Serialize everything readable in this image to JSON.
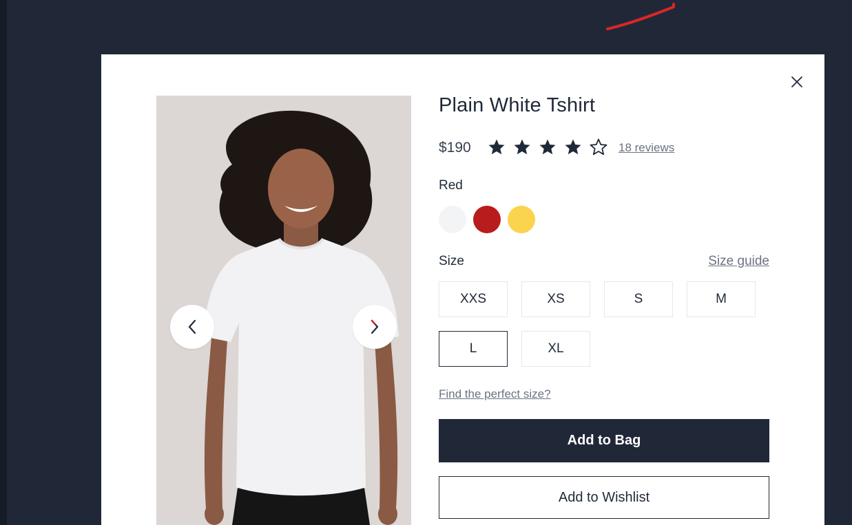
{
  "product": {
    "title": "Plain White Tshirt",
    "price": "$190",
    "rating": 4,
    "rating_max": 5,
    "reviews_link": "18 reviews"
  },
  "color": {
    "selected_label": "Red",
    "swatches": [
      {
        "name": "White",
        "hex": "#f3f4f6"
      },
      {
        "name": "Red",
        "hex": "#b91c1c"
      },
      {
        "name": "Yellow",
        "hex": "#fcd34d"
      }
    ]
  },
  "size": {
    "label": "Size",
    "guide_link": "Size guide",
    "options": [
      "XXS",
      "XS",
      "S",
      "M",
      "L",
      "XL"
    ],
    "selected": "L",
    "find_link": "Find the perfect size?"
  },
  "actions": {
    "add_to_bag": "Add to Bag",
    "add_to_wishlist": "Add to Wishlist"
  },
  "colors": {
    "backdrop": "#202838",
    "primary_button": "#202838",
    "stroke_annotation": "#dc2626"
  },
  "icons": {
    "close": "close-icon",
    "prev": "chevron-left-icon",
    "next": "chevron-right-icon",
    "star_filled": "star-filled-icon",
    "star_outline": "star-outline-icon"
  }
}
